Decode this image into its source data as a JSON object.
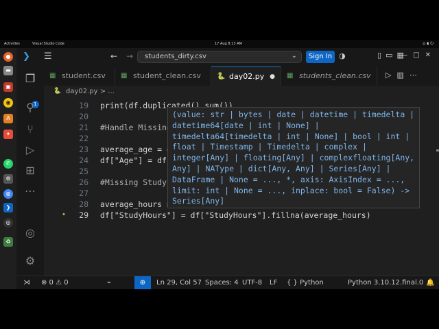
{
  "topbar": {
    "activities": "Activities",
    "app_name": "Visual Studio Code",
    "clock": "17 Aug  8:13 AM"
  },
  "dock": {
    "icons": [
      "firefox-icon",
      "files-icon",
      "snap-icon",
      "rhythmbox-icon",
      "software-icon",
      "whatsapp-icon",
      "settings-icon",
      "chrome-icon",
      "vscode-icon",
      "obs-icon",
      "trash-icon"
    ]
  },
  "titlebar": {
    "search_text": "students_dirty.csv",
    "signin_label": "Sign In"
  },
  "activity_bar": {
    "explorer_badge": "1"
  },
  "tabs": [
    {
      "label": "student.csv",
      "icon": "▦"
    },
    {
      "label": "student_clean.csv",
      "icon": "▦"
    },
    {
      "label": "day02.py",
      "icon": "🐍",
      "active": true,
      "modified_marker": "●"
    },
    {
      "label": "students_clean.csv",
      "icon": "▦"
    }
  ],
  "breadcrumb": {
    "file": "day02.py",
    "sep": "> ..."
  },
  "code_lines": [
    {
      "num": "19",
      "text": "print(df.duplicated().sum())"
    },
    {
      "num": "20",
      "text": ""
    },
    {
      "num": "21",
      "text": "#Handle Missing Age"
    },
    {
      "num": "22",
      "text": ""
    },
    {
      "num": "23",
      "text": "average_age = df['Age'"
    },
    {
      "num": "24",
      "text": "df[\"Age\"] = df[\"Age\"]"
    },
    {
      "num": "25",
      "text": ""
    },
    {
      "num": "26",
      "text": "#Missing Study Hours"
    },
    {
      "num": "27",
      "text": ""
    },
    {
      "num": "28",
      "text": "average_hours = df['S"
    },
    {
      "num": "29",
      "text": "df[\"StudyHours\"] = df[\"StudyHours\"].fillna(average_hours)"
    }
  ],
  "hover_signature": "(value: str | bytes | date | datetime | timedelta | datetime64[date | int | None] | timedelta64[timedelta | int | None] | bool | int | float | Timestamp | Timedelta | complex | integer[Any] | floating[Any] | complexfloating[Any, Any] | NAType | dict[Any, Any] | Series[Any] | DataFrame | None = ..., *, axis: AxisIndex = ..., limit: int | None = ..., inplace: bool = False) -> Series[Any]",
  "statusbar": {
    "problems": "⊗ 0 ⚠ 0",
    "cursor": "Ln 29, Col 57",
    "spaces": "Spaces: 4",
    "encoding": "UTF-8",
    "eol": "LF",
    "language": "{ } Python",
    "interpreter": "Python 3.10.12.final.0"
  }
}
